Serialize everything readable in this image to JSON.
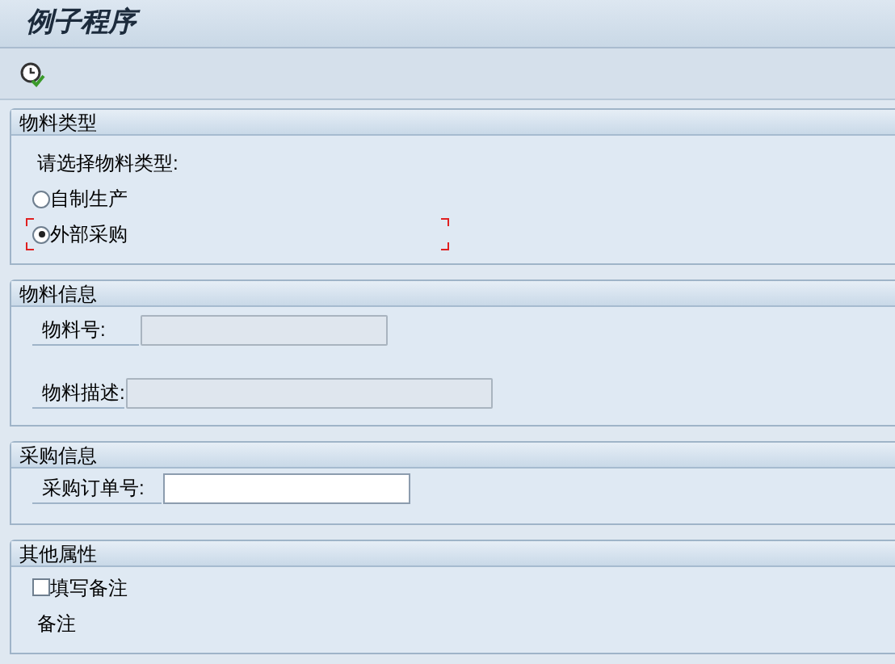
{
  "window": {
    "title": "例子程序"
  },
  "sections": [
    {
      "title": "物料类型",
      "items": [
        {
          "kind": "label",
          "text": "请选择物料类型:"
        },
        {
          "kind": "radio",
          "label": "自制生产",
          "selected": false,
          "focused": false
        },
        {
          "kind": "radio",
          "label": "外部采购",
          "selected": true,
          "focused": true
        }
      ]
    },
    {
      "title": "物料信息",
      "items": [
        {
          "kind": "field",
          "label": "物料号:",
          "disabled": true
        },
        {
          "kind": "field",
          "label": "物料描述:",
          "disabled": true
        }
      ]
    },
    {
      "title": "采购信息",
      "items": [
        {
          "kind": "field",
          "label": "采购订单号:",
          "disabled": false
        }
      ]
    },
    {
      "title": "其他属性",
      "items": [
        {
          "kind": "checkbox",
          "label": "填写备注",
          "checked": false
        },
        {
          "kind": "label",
          "text": "备注"
        }
      ]
    }
  ]
}
